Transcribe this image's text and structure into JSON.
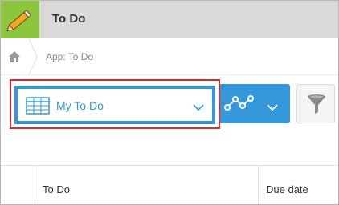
{
  "app": {
    "title": "To Do"
  },
  "breadcrumb": {
    "app_label": "App: To Do"
  },
  "toolbar": {
    "view_select": {
      "selected": "My To Do"
    }
  },
  "table": {
    "columns": [
      "To Do",
      "Due date"
    ]
  },
  "colors": {
    "accent": "#3498db",
    "highlight": "#e0262a",
    "app_icon_bg": "#8cc63f",
    "header_bg": "#d9d9d9"
  },
  "icons": {
    "app": "pencil-icon",
    "home": "home-icon",
    "view": "table-grid-icon",
    "graph": "line-graph-icon",
    "filter": "funnel-icon"
  }
}
